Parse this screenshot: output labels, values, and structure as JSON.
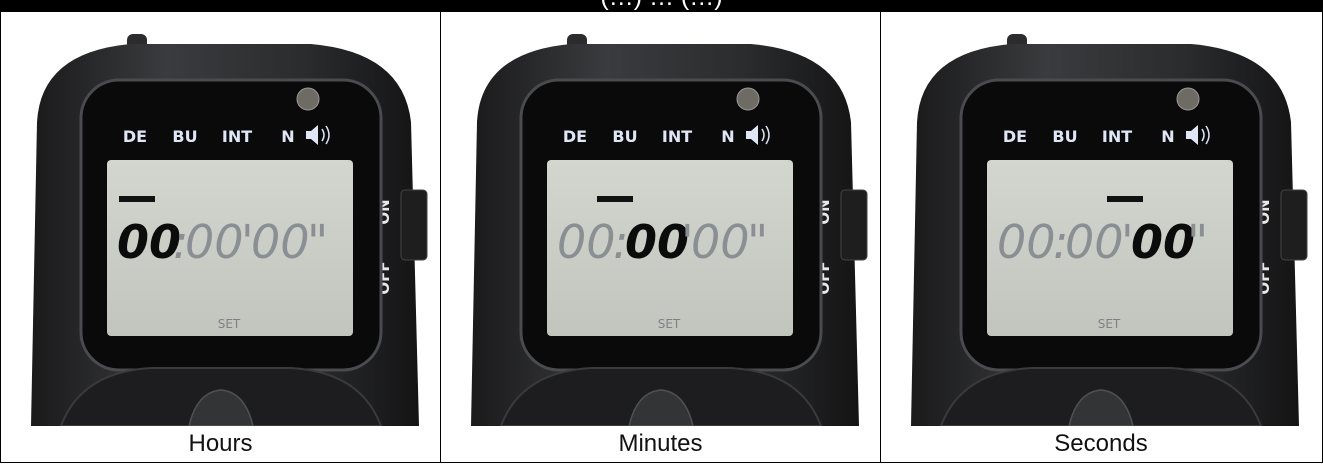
{
  "header": {
    "title": "(…) … (…)"
  },
  "device": {
    "mode_labels": [
      "DE",
      "BU",
      "INT",
      "N"
    ],
    "sound_icon": "speaker-icon",
    "digits": {
      "hours": "00",
      "minutes": "00",
      "seconds": "00",
      "sep1": ":",
      "sep2": "'",
      "sep3": "\""
    },
    "set_label": "SET",
    "switch_on": "ON",
    "switch_off": "OFF"
  },
  "panels": [
    {
      "caption": "Hours",
      "active": "hours"
    },
    {
      "caption": "Minutes",
      "active": "minutes"
    },
    {
      "caption": "Seconds",
      "active": "seconds"
    }
  ],
  "colors": {
    "lcd": "#c9ccc4",
    "body": "#2a2a2c",
    "active_digit": "#0b0b0b",
    "inactive_digit": "#8a8f94",
    "mode_text": "#dfe6f5"
  }
}
